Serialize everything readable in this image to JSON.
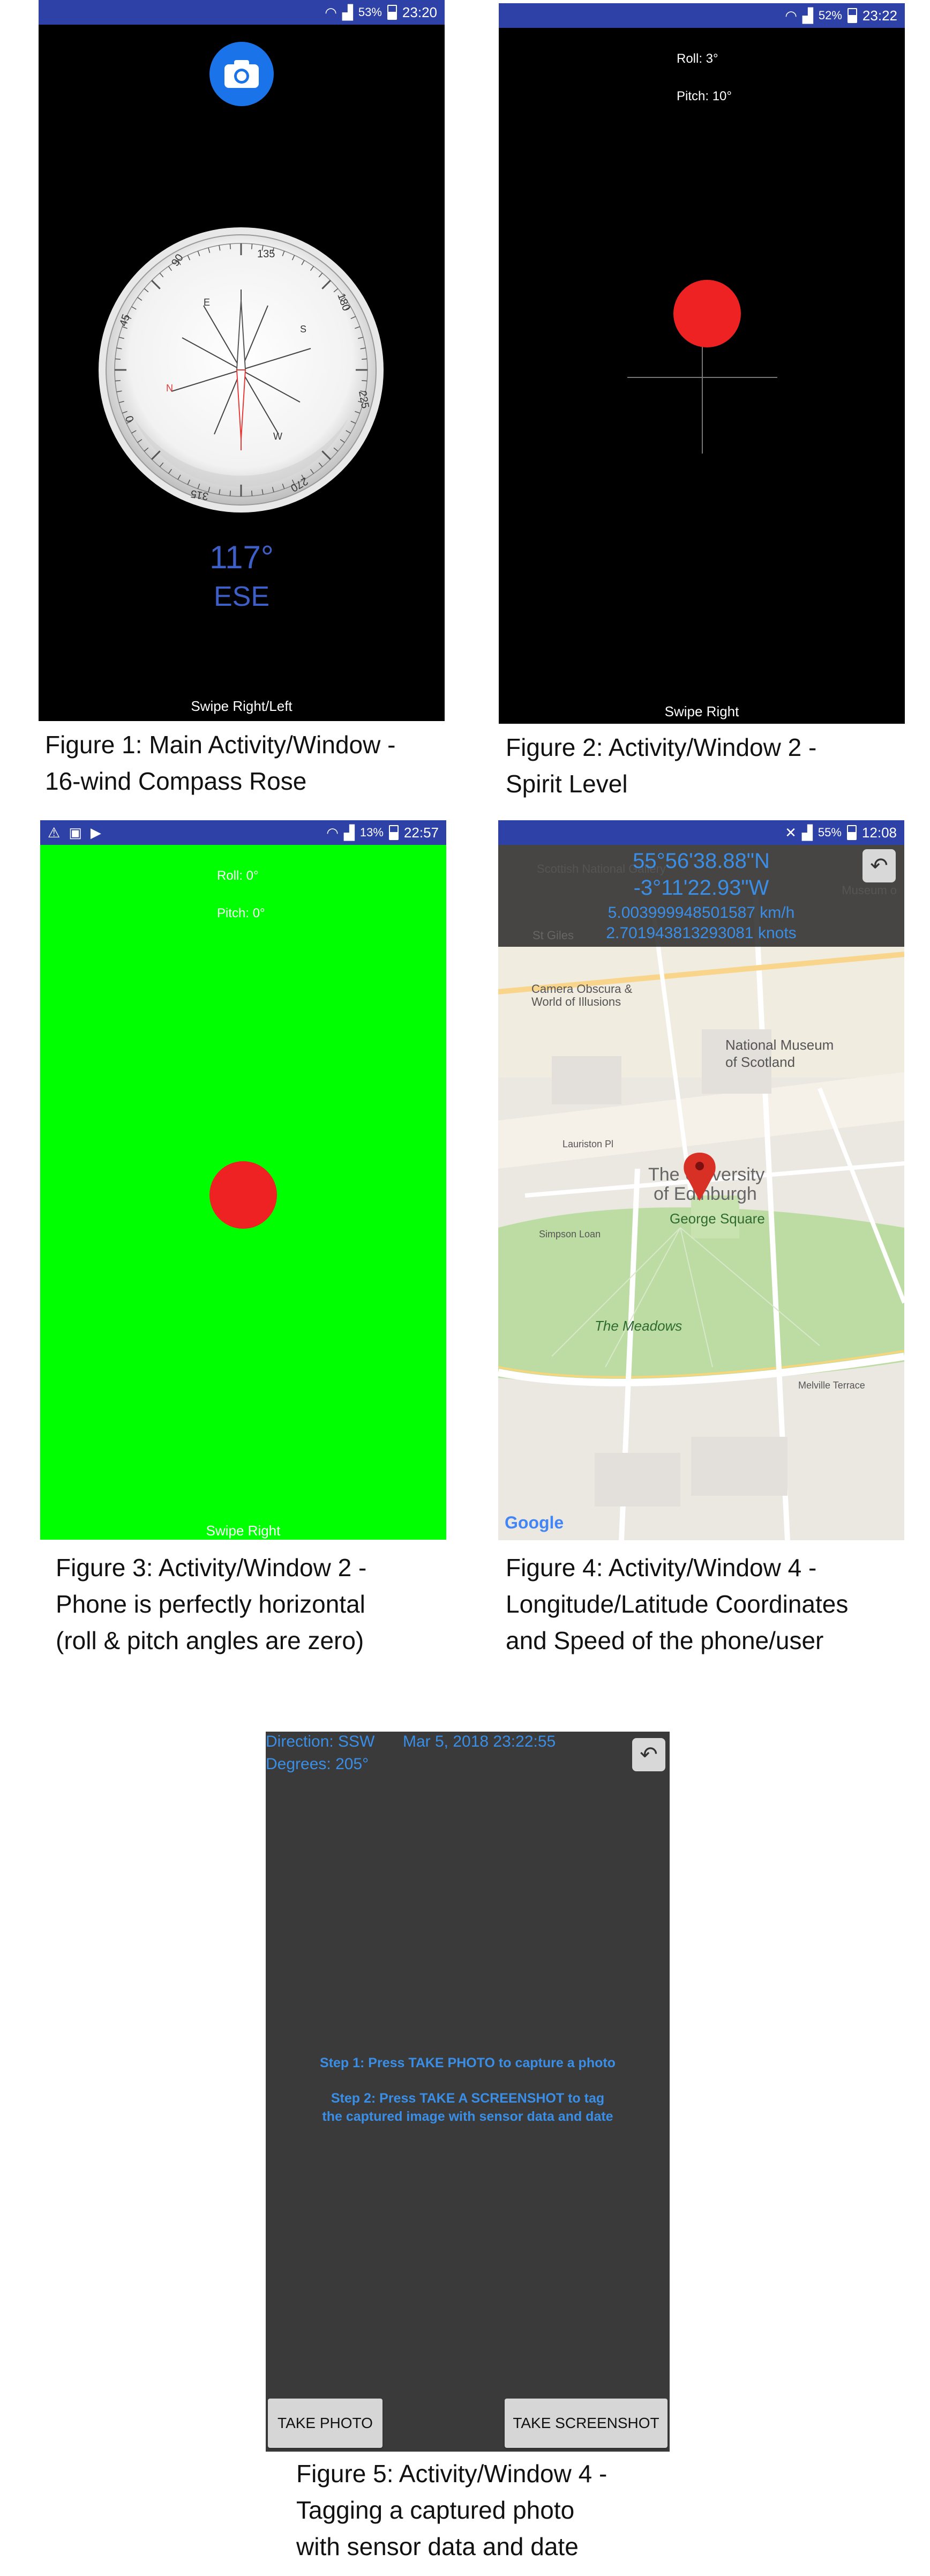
{
  "panel1": {
    "status": {
      "battery": "53%",
      "time": "23:20"
    },
    "camera_icon": "camera-icon",
    "compass": {
      "labels": [
        "90",
        "135",
        "180",
        "225",
        "270",
        "315",
        "0",
        "45"
      ],
      "inner": [
        "E",
        "S",
        "W",
        "N"
      ]
    },
    "degrees": "117°",
    "direction": "ESE",
    "footer": "Swipe Right/Left",
    "caption": "Figure 1: Main Activity/Window -\n16-wind Compass Rose"
  },
  "panel2": {
    "status": {
      "battery": "52%",
      "time": "23:22"
    },
    "roll": "Roll: 3°",
    "pitch": "Pitch: 10°",
    "footer": "Swipe Right",
    "caption": "Figure 2: Activity/Window 2 -\nSpirit Level"
  },
  "panel3": {
    "status": {
      "battery": "13%",
      "time": "22:57"
    },
    "roll": "Roll: 0°",
    "pitch": "Pitch: 0°",
    "footer": "Swipe Right",
    "caption": "Figure 3: Activity/Window 2 -\nPhone is perfectly horizontal\n(roll & pitch angles are zero)"
  },
  "panel4": {
    "status": {
      "battery": "55%",
      "time": "12:08"
    },
    "lat": "55°56'38.88\"N",
    "lon": "-3°11'22.93\"W",
    "speed_kmh": "5.003999948501587 km/h",
    "speed_knots": "2.701943813293081 knots",
    "map_labels": {
      "scottish": "Scottish National Gallery",
      "museum_of": "Museum o",
      "st_giles": "St Giles",
      "camera1": "Camera Obscura &",
      "camera2": "World of Illusions",
      "natmus1": "National Museum",
      "natmus2": "of Scotland",
      "univ1": "The University",
      "univ2": "of Edinburgh",
      "george": "George Square",
      "meadows": "The Meadows",
      "melville": "Melville Terrace",
      "lauriston": "Lauriston Pl",
      "simpson": "Simpson Loan",
      "google": "Google"
    },
    "caption": "Figure 4: Activity/Window 4 -\nLongitude/Latitude Coordinates\nand Speed of the phone/user"
  },
  "panel5": {
    "direction": "Direction: SSW",
    "datetime": "Mar 5, 2018 23:22:55",
    "degrees": "Degrees: 205°",
    "step1": "Step 1: Press TAKE PHOTO to capture a photo",
    "step2a": "Step 2: Press TAKE A SCREENSHOT to tag",
    "step2b": "the captured image with sensor data and date",
    "take_photo": "TAKE PHOTO",
    "take_screenshot": "TAKE SCREENSHOT",
    "caption": "Figure 5: Activity/Window 4 -\nTagging a captured photo\nwith sensor data and date"
  },
  "colors": {
    "statusbar": "#2e41a6",
    "accent_blue": "#3a8ee6",
    "compass_blue": "#3f5fc8",
    "level_red": "#ee2222",
    "level_green": "#00ff00",
    "dark_panel": "#3a3a3a"
  }
}
